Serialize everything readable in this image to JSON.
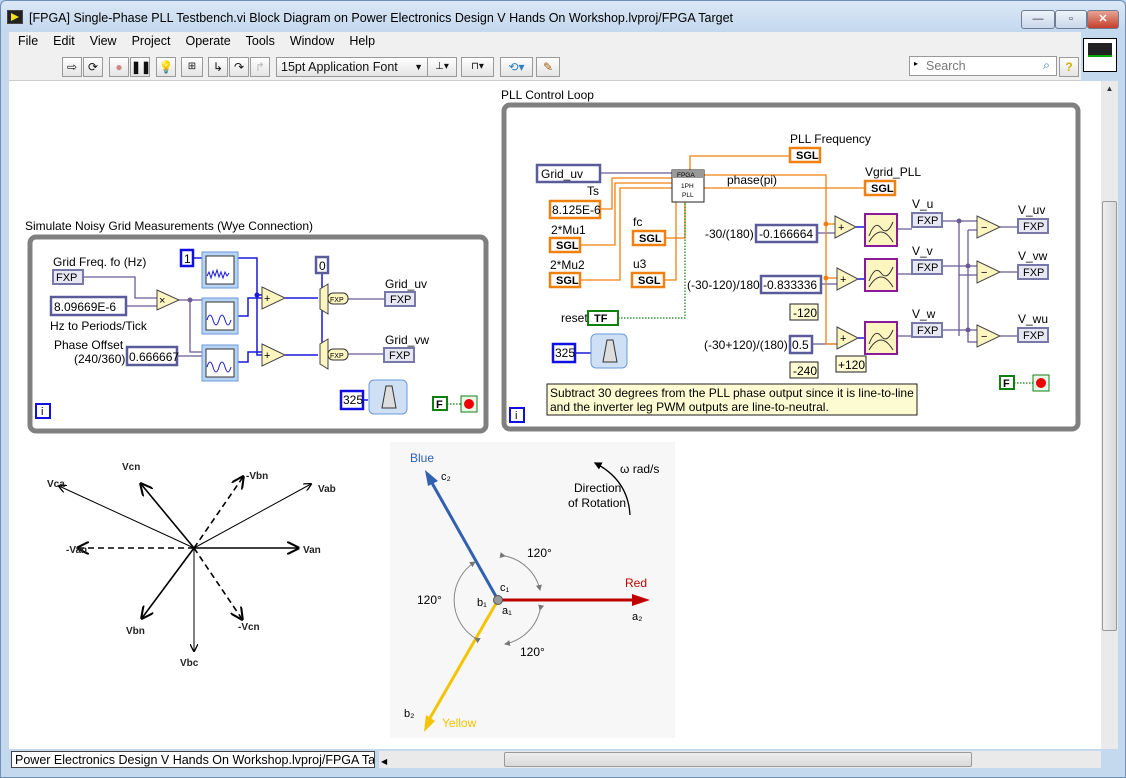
{
  "window": {
    "title": "[FPGA] Single-Phase PLL Testbench.vi Block Diagram on Power Electronics Design V Hands On Workshop.lvproj/FPGA Target",
    "minimize": "—",
    "maximize": "▫",
    "close": "✕"
  },
  "menu": [
    "File",
    "Edit",
    "View",
    "Project",
    "Operate",
    "Tools",
    "Window",
    "Help"
  ],
  "toolbar": {
    "font": "15pt Application Font",
    "search_placeholder": "Search",
    "help": "?"
  },
  "status": {
    "context": "Power Electronics Design V Hands On Workshop.lvproj/FPGA Target"
  },
  "colors": {
    "wire_int": "#1a1ad8",
    "wire_fxp": "#6a5a98",
    "wire_sgl": "#f08010",
    "wire_bool": "#108010",
    "red_phase": "#c00000",
    "blue_phase": "#3060b0",
    "yellow_phase": "#f5c400"
  },
  "sim_loop": {
    "label": "Simulate Noisy Grid Measurements (Wye Connection)",
    "grid_freq_label": "Grid Freq. fo (Hz)",
    "fxp": "FXP",
    "hz_const": "8.09669E-6",
    "hz_label": "Hz to Periods/Tick",
    "phase_label1": "Phase Offset",
    "phase_label2": "(240/360)",
    "phase_const": "0.666667",
    "noise_const": "1",
    "zero_const": "0",
    "mult": "×",
    "add": "+",
    "conv": "FXP",
    "grid_uv": "Grid_uv",
    "grid_vw": "Grid_vw",
    "timer_const": "325",
    "stop_const": "F",
    "iter": "i"
  },
  "pll_loop": {
    "label": "PLL Control Loop",
    "grid_uv_ctrl": "Grid_uv",
    "ts_label": "Ts",
    "ts_const": "8.125E-6",
    "mu1": "2*Mu1",
    "mu2": "2*Mu2",
    "fc": "fc",
    "u3": "u3",
    "sgl": "SGL",
    "fpga_tag": "FPGA",
    "pll_l1": "1PH",
    "pll_l2": "PLL",
    "pll_freq": "PLL Frequency",
    "phase": "phase(pi)",
    "vgrid": "Vgrid_PLL",
    "c1_label": "-30/(180)",
    "c1": "-0.166664",
    "c2_label": "(-30-120)/180",
    "c2": "-0.833336",
    "c3_label": "(-30+120)/(180)",
    "c3": "0.5",
    "m120": "-120",
    "m240": "-240",
    "p120": "+120",
    "add": "+",
    "sub": "−",
    "fxp": "FXP",
    "v_u": "V_u",
    "v_v": "V_v",
    "v_w": "V_w",
    "v_uv": "V_uv",
    "v_vw": "V_vw",
    "v_wu": "V_wu",
    "reset": "reset",
    "tf": "TF",
    "timer_const": "325",
    "comment1": "Subtract 30 degrees  from the PLL phase output since it is line-to-line",
    "comment2": "and the inverter leg PWM outputs are line-to-neutral.",
    "stop_const": "F",
    "iter": "i"
  },
  "phasor_lines": {
    "van": "Van",
    "nvan": "-Van",
    "vab": "Vab",
    "vca": "Vca",
    "vcn": "Vcn",
    "nvbn": "-Vbn",
    "vbn": "Vbn",
    "vbc": "Vbc",
    "nvcn": "-Vcn"
  },
  "phasor_rot": {
    "blue": "Blue",
    "red": "Red",
    "yellow": "Yellow",
    "c2": "c₂",
    "a2": "a₂",
    "b2": "b₂",
    "c1": "c₁",
    "b1": "b₁",
    "a1": "a₁",
    "deg1": "120°",
    "deg2": "120°",
    "deg3": "120°",
    "dir1": "Direction",
    "dir2": "of Rotation",
    "omega": "ω rad/s"
  }
}
